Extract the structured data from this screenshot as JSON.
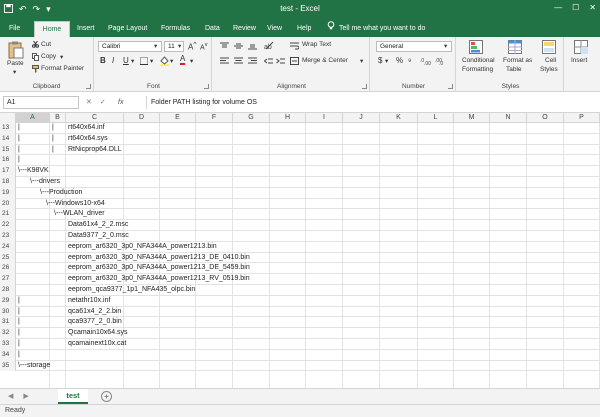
{
  "title_bar": {
    "title": "test - Excel",
    "qa_icons": [
      "save-icon",
      "undo-icon",
      "redo-icon",
      "customize-icon"
    ],
    "window_buttons": [
      "minimize-icon",
      "maximize-icon",
      "close-icon"
    ],
    "accent_color": "#217346"
  },
  "ribbon_tabs": [
    "File",
    "Home",
    "Insert",
    "Page Layout",
    "Formulas",
    "Data",
    "Review",
    "View",
    "Help"
  ],
  "active_tab": "Home",
  "tell_me": "Tell me what you want to do",
  "ribbon": {
    "clipboard": {
      "label": "Clipboard",
      "paste": "Paste",
      "cut": "Cut",
      "copy": "Copy",
      "format_painter": "Format Painter"
    },
    "font": {
      "label": "Font",
      "font_name": "Calibri",
      "font_size": "11",
      "bold": "B",
      "italic": "I",
      "underline": "U",
      "font_color_letter": "A"
    },
    "alignment": {
      "label": "Alignment",
      "wrap_text": "Wrap Text",
      "merge_center": "Merge & Center"
    },
    "number": {
      "label": "Number",
      "format": "General",
      "currency": "$",
      "percent": "%"
    },
    "styles": {
      "label": "Styles",
      "conditional_line1": "Conditional",
      "conditional_line2": "Formatting",
      "format_table_line1": "Format as",
      "format_table_line2": "Table",
      "cell_styles_line1": "Cell",
      "cell_styles_line2": "Styles"
    },
    "cells": {
      "insert": "Insert"
    }
  },
  "formula_bar": {
    "name_box": "A1",
    "fx": "fx",
    "content": "Folder PATH listing for volume OS"
  },
  "columns": [
    "A",
    "B",
    "C",
    "D",
    "E",
    "F",
    "G",
    "H",
    "I",
    "J",
    "K",
    "L",
    "M",
    "N",
    "O",
    "P"
  ],
  "selected_column": "A",
  "rows": [
    {
      "num": "13",
      "a": "|",
      "b": "|",
      "c": "rt640x64.inf"
    },
    {
      "num": "14",
      "a": "|",
      "b": "|",
      "c": "rt640x64.sys"
    },
    {
      "num": "15",
      "a": "|",
      "b": "|",
      "c": "RtNicprop64.DLL"
    },
    {
      "num": "16",
      "a": "|",
      "b": "",
      "c": ""
    },
    {
      "num": "17",
      "a": "\\---K98VK",
      "b": "",
      "c": ""
    },
    {
      "num": "18",
      "a": "",
      "b": "\\---drivers",
      "c": ""
    },
    {
      "num": "19",
      "a": "",
      "b": "\\---Production",
      "c": ""
    },
    {
      "num": "20",
      "a": "",
      "b": "\\---Windows10-x64",
      "c": ""
    },
    {
      "num": "21",
      "a": "",
      "b": "\\---WLAN_driver",
      "c": ""
    },
    {
      "num": "22",
      "a": "",
      "b": "",
      "c": "Data61x4_2_2.msc"
    },
    {
      "num": "23",
      "a": "",
      "b": "",
      "c": "Data9377_2_0.msc"
    },
    {
      "num": "24",
      "a": "",
      "b": "",
      "c": "eeprom_ar6320_3p0_NFA344A_power1213.bin"
    },
    {
      "num": "25",
      "a": "",
      "b": "",
      "c": "eeprom_ar6320_3p0_NFA344A_power1213_DE_0410.bin"
    },
    {
      "num": "26",
      "a": "",
      "b": "",
      "c": "eeprom_ar6320_3p0_NFA344A_power1213_DE_5459.bin"
    },
    {
      "num": "27",
      "a": "",
      "b": "",
      "c": "eeprom_ar6320_3p0_NFA344A_power1213_RV_0519.bin"
    },
    {
      "num": "28",
      "a": "",
      "b": "",
      "c": "eeprom_qca9377_1p1_NFA435_olpc.bin"
    },
    {
      "num": "29",
      "a": "|",
      "b": "",
      "c": "netathr10x.inf"
    },
    {
      "num": "30",
      "a": "|",
      "b": "",
      "c": "qca61x4_2_2.bin"
    },
    {
      "num": "31",
      "a": "|",
      "b": "",
      "c": "qca9377_2_0.bin"
    },
    {
      "num": "32",
      "a": "|",
      "b": "",
      "c": "Qcamain10x64.sys"
    },
    {
      "num": "33",
      "a": "|",
      "b": "",
      "c": "qcamainext10x.cat"
    },
    {
      "num": "34",
      "a": "|",
      "b": "",
      "c": ""
    },
    {
      "num": "35",
      "a": "\\---storage",
      "b": "",
      "c": ""
    }
  ],
  "sheet_tabs": [
    "test"
  ],
  "add_sheet": "+",
  "status": "Ready"
}
